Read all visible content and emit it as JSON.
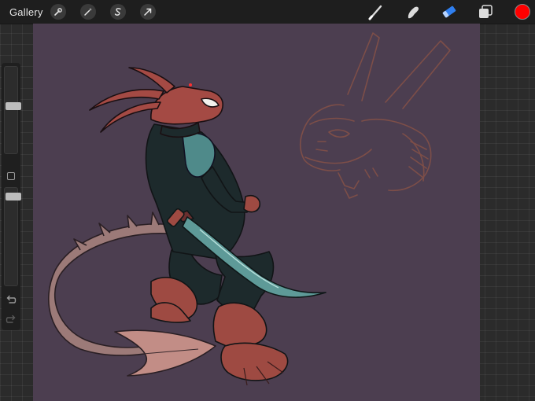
{
  "toolbar": {
    "gallery_label": "Gallery",
    "actions_icon": "wrench-icon",
    "adjustments_icon": "magic-wand-icon",
    "selection_icon": "selection-s-icon",
    "transform_icon": "arrow-cursor-icon",
    "brush_icon": "brush-icon",
    "smudge_icon": "smudge-finger-icon",
    "eraser_icon": "eraser-icon",
    "layers_icon": "layers-icon",
    "active_color": "#ff0000",
    "eraser_active_color": "#2f7ff0"
  },
  "sidebar": {
    "brush_size_icon": "size-slider",
    "opacity_icon": "opacity-slider",
    "modify_icon": "square-icon",
    "undo_icon": "undo-icon",
    "redo_icon": "redo-icon",
    "brush_size_level": 0.55,
    "opacity_level": 0.05
  },
  "canvas": {
    "background_color": "#4c3e50",
    "artwork": "dragon-warrior-illustration",
    "sketch": "dragon-head-sketch"
  }
}
